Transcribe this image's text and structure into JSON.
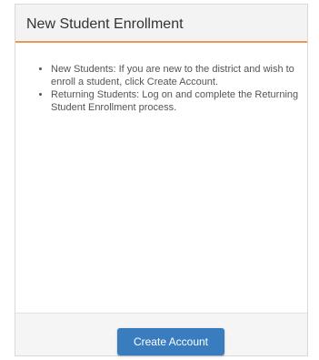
{
  "panel": {
    "title": "New Student Enrollment",
    "items": [
      "New Students: If you are new to the district and wish to enroll a student, click Create Account.",
      "Returning Students: Log on and complete the Returning Student Enrollment process."
    ],
    "create_account_label": "Create Account"
  },
  "colors": {
    "header_accent": "#e99a55",
    "button_primary": "#3a7dbf"
  }
}
